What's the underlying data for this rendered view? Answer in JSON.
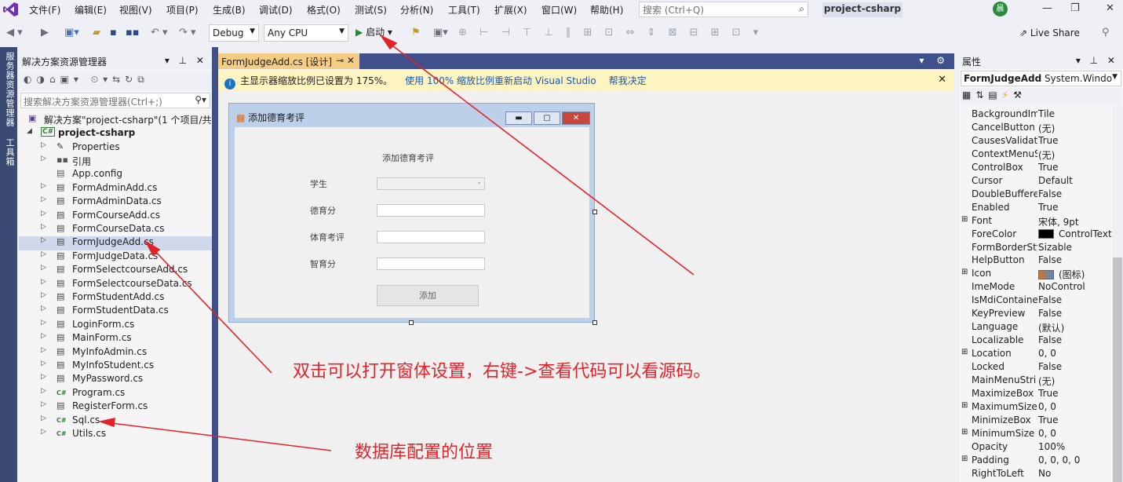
{
  "menubar": {
    "items": [
      "文件(F)",
      "编辑(E)",
      "视图(V)",
      "项目(P)",
      "生成(B)",
      "调试(D)",
      "格式(O)",
      "测试(S)",
      "分析(N)",
      "工具(T)",
      "扩展(X)",
      "窗口(W)",
      "帮助(H)"
    ],
    "search_placeholder": "搜索 (Ctrl+Q)",
    "project_title": "project-csharp",
    "avatar_text": "晨"
  },
  "toolbar": {
    "config": "Debug",
    "platform": "Any CPU",
    "start_label": "启动",
    "live_share": "Live Share"
  },
  "side_tabs": {
    "server_explorer": "服务器资源管理器",
    "toolbox": "工具箱"
  },
  "solution_explorer": {
    "title": "解决方案资源管理器",
    "search_placeholder": "搜索解决方案资源管理器(Ctrl+;)",
    "solution_label": "解决方案\"project-csharp\"(1 个项目/共 1",
    "project": "project-csharp",
    "items": [
      {
        "label": "Properties",
        "icon": "wrench",
        "expand": true
      },
      {
        "label": "引用",
        "icon": "ref",
        "expand": true
      },
      {
        "label": "App.config",
        "icon": "config",
        "expand": false
      },
      {
        "label": "FormAdminAdd.cs",
        "icon": "form",
        "expand": true
      },
      {
        "label": "FormAdminData.cs",
        "icon": "form",
        "expand": true
      },
      {
        "label": "FormCourseAdd.cs",
        "icon": "form",
        "expand": true
      },
      {
        "label": "FormCourseData.cs",
        "icon": "form",
        "expand": true
      },
      {
        "label": "FormJudgeAdd.cs",
        "icon": "form",
        "expand": true,
        "selected": true
      },
      {
        "label": "FormJudgeData.cs",
        "icon": "form",
        "expand": true
      },
      {
        "label": "FormSelectcourseAdd.cs",
        "icon": "form",
        "expand": true
      },
      {
        "label": "FormSelectcourseData.cs",
        "icon": "form",
        "expand": true
      },
      {
        "label": "FormStudentAdd.cs",
        "icon": "form",
        "expand": true
      },
      {
        "label": "FormStudentData.cs",
        "icon": "form",
        "expand": true
      },
      {
        "label": "LoginForm.cs",
        "icon": "form",
        "expand": true
      },
      {
        "label": "MainForm.cs",
        "icon": "form",
        "expand": true
      },
      {
        "label": "MyInfoAdmin.cs",
        "icon": "form",
        "expand": true
      },
      {
        "label": "MyInfoStudent.cs",
        "icon": "form",
        "expand": true
      },
      {
        "label": "MyPassword.cs",
        "icon": "form",
        "expand": true
      },
      {
        "label": "Program.cs",
        "icon": "cs",
        "expand": true
      },
      {
        "label": "RegisterForm.cs",
        "icon": "form",
        "expand": true
      },
      {
        "label": "Sql.cs",
        "icon": "cs",
        "expand": true
      },
      {
        "label": "Utils.cs",
        "icon": "cs",
        "expand": true
      }
    ]
  },
  "document": {
    "tab_label": "FormJudgeAdd.cs [设计]",
    "info_text": "主显示器缩放比例已设置为 175%。",
    "info_link1": "使用 100% 缩放比例重新启动 Visual Studio",
    "info_link2": "帮我决定"
  },
  "form": {
    "title": "添加德育考评",
    "heading": "添加德育考评",
    "fields": [
      "学生",
      "德育分",
      "体育考评",
      "智育分"
    ],
    "button": "添加"
  },
  "properties": {
    "title": "属性",
    "object_name": "FormJudgeAdd",
    "object_type": "System.Windo",
    "rows": [
      {
        "name": "BackgroundIm",
        "value": "Tile"
      },
      {
        "name": "CancelButton",
        "value": "(无)"
      },
      {
        "name": "CausesValidati",
        "value": "True"
      },
      {
        "name": "ContextMenuS",
        "value": "(无)"
      },
      {
        "name": "ControlBox",
        "value": "True"
      },
      {
        "name": "Cursor",
        "value": "Default"
      },
      {
        "name": "DoubleBuffere",
        "value": "False"
      },
      {
        "name": "Enabled",
        "value": "True"
      },
      {
        "name": "Font",
        "value": "宋体, 9pt",
        "expand": true
      },
      {
        "name": "ForeColor",
        "value": "ControlText",
        "swatch": "#000000"
      },
      {
        "name": "FormBorderSty",
        "value": "Sizable"
      },
      {
        "name": "HelpButton",
        "value": "False"
      },
      {
        "name": "Icon",
        "value": "(图标)",
        "expand": true,
        "swatch": "icon"
      },
      {
        "name": "ImeMode",
        "value": "NoControl"
      },
      {
        "name": "IsMdiContaine",
        "value": "False"
      },
      {
        "name": "KeyPreview",
        "value": "False"
      },
      {
        "name": "Language",
        "value": "(默认)"
      },
      {
        "name": "Localizable",
        "value": "False"
      },
      {
        "name": "Location",
        "value": "0, 0",
        "expand": true
      },
      {
        "name": "Locked",
        "value": "False"
      },
      {
        "name": "MainMenuStri",
        "value": "(无)"
      },
      {
        "name": "MaximizeBox",
        "value": "True"
      },
      {
        "name": "MaximumSize",
        "value": "0, 0",
        "expand": true
      },
      {
        "name": "MinimizeBox",
        "value": "True"
      },
      {
        "name": "MinimumSize",
        "value": "0, 0",
        "expand": true
      },
      {
        "name": "Opacity",
        "value": "100%"
      },
      {
        "name": "Padding",
        "value": "0, 0, 0, 0",
        "expand": true
      },
      {
        "name": "RightToLeft",
        "value": "No"
      }
    ]
  },
  "annotations": {
    "note1": "双击可以打开窗体设置，右键->查看代码可以看源码。",
    "note2": "数据库配置的位置",
    "color": "#e2232a"
  }
}
